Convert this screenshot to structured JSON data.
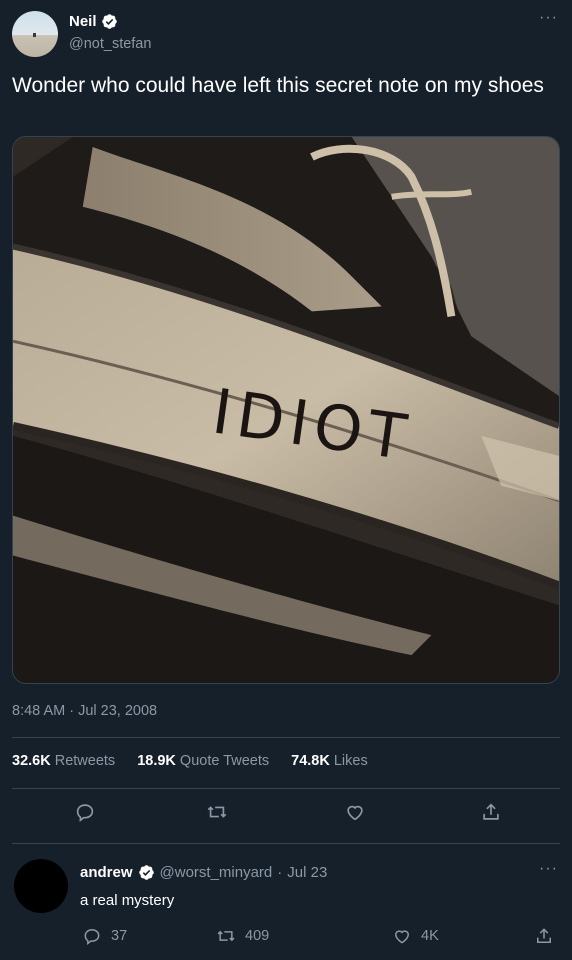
{
  "author": {
    "name": "Neil",
    "handle": "@not_stefan"
  },
  "tweet": {
    "text": "Wonder who could have left this secret note on my shoes",
    "image_text": "IDIOT",
    "timestamp": "8:48 AM · Jul 23, 2008"
  },
  "stats": {
    "retweets_count": "32.6K",
    "retweets_label": "Retweets",
    "quotes_count": "18.9K",
    "quotes_label": "Quote Tweets",
    "likes_count": "74.8K",
    "likes_label": "Likes"
  },
  "more_menu": "···",
  "reply": {
    "name": "andrew",
    "handle": "@worst_minyard",
    "separator": "·",
    "date": "Jul 23",
    "text": "a real mystery",
    "reply_count": "37",
    "retweet_count": "409",
    "like_count": "4K"
  },
  "colors": {
    "background": "#15202b",
    "secondary_text": "#8b98a5",
    "divider": "#38444d",
    "verified": "#ffffff"
  },
  "icons": {
    "reply": "reply-icon",
    "retweet": "retweet-icon",
    "like": "heart-icon",
    "share": "share-icon",
    "verified": "verified-badge-icon",
    "more": "more-icon"
  }
}
